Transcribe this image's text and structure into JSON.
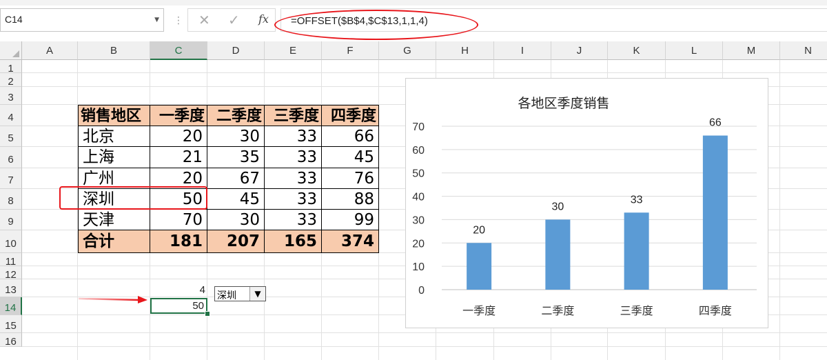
{
  "name_box": {
    "value": "C14"
  },
  "formula_bar": {
    "cancel_symbol": "✕",
    "enter_symbol": "✓",
    "fx_label": "fx",
    "formula": "=OFFSET($B$4,$C$13,1,1,4)"
  },
  "columns": [
    "A",
    "B",
    "C",
    "D",
    "E",
    "F",
    "G",
    "H",
    "I",
    "J",
    "K",
    "L",
    "M",
    "N"
  ],
  "rows": [
    "1",
    "2",
    "3",
    "4",
    "5",
    "6",
    "7",
    "8",
    "9",
    "10",
    "11",
    "12",
    "13",
    "14",
    "15",
    "16"
  ],
  "selected_cell": "C14",
  "table": {
    "headers": [
      "销售地区",
      "一季度",
      "二季度",
      "三季度",
      "四季度"
    ],
    "rows": [
      [
        "北京",
        "20",
        "30",
        "33",
        "66"
      ],
      [
        "上海",
        "21",
        "35",
        "33",
        "45"
      ],
      [
        "广州",
        "20",
        "67",
        "33",
        "76"
      ],
      [
        "深圳",
        "50",
        "45",
        "33",
        "88"
      ],
      [
        "天津",
        "70",
        "30",
        "33",
        "99"
      ]
    ],
    "total": [
      "合计",
      "181",
      "207",
      "165",
      "374"
    ],
    "header_color": "#f8cbad"
  },
  "cells": {
    "C13": "4",
    "C14": "50"
  },
  "dropdown": {
    "selected": "深圳"
  },
  "chart_data": {
    "type": "bar",
    "title": "各地区季度销售",
    "categories": [
      "一季度",
      "二季度",
      "三季度",
      "四季度"
    ],
    "values": [
      20,
      30,
      33,
      66
    ],
    "data_labels": [
      "20",
      "30",
      "33",
      "66"
    ],
    "y_ticks": [
      "0",
      "10",
      "20",
      "30",
      "40",
      "50",
      "60",
      "70"
    ],
    "ylim": [
      0,
      70
    ],
    "bar_color": "#5b9bd5",
    "grid": true,
    "legend": "none"
  },
  "annotations": {
    "highlight_color": "#e8161b"
  }
}
